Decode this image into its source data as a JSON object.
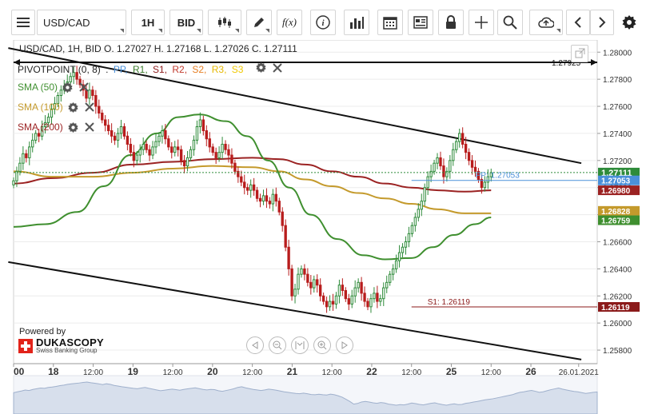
{
  "toolbar": {
    "menu_icon": "hamburger-icon",
    "symbol": "USD/CAD",
    "timeframe": "1H",
    "price_side": "BID",
    "buttons": [
      "candle-type-icon",
      "draw-pencil-icon",
      "fx-icon",
      "info-icon",
      "bar-chart-icon",
      "calendar-icon",
      "news-icon",
      "lock-icon",
      "crosshair-icon",
      "zoom-icon",
      "upload-icon",
      "chevron-left-icon",
      "chevron-right-icon",
      "gear-icon"
    ],
    "fx_label": "f(x)"
  },
  "header": {
    "ohlc_line": "USD/CAD, 1H, BID   O. 1.27027 H. 1.27168 L. 1.27026 C. 1.27111"
  },
  "pivot": {
    "label": "PIVOTPOINT (0, 8)",
    "sep": ":",
    "items": [
      {
        "text": "PP,",
        "color": "#4a90d9"
      },
      {
        "text": "R1,",
        "color": "#3a7a2a"
      },
      {
        "text": "S1,",
        "color": "#8b1a1a"
      },
      {
        "text": "R2,",
        "color": "#c0392b"
      },
      {
        "text": "S2,",
        "color": "#e67e22"
      },
      {
        "text": "R3,",
        "color": "#e6b800"
      },
      {
        "text": "S3",
        "color": "#f0c800"
      }
    ]
  },
  "indicators": [
    {
      "label": "SMA (50)",
      "color": "#3f8f2f"
    },
    {
      "label": "SMA (100)",
      "color": "#c49a2c"
    },
    {
      "label": "SMA (200)",
      "color": "#9b2222"
    }
  ],
  "branding": {
    "powered_by": "Powered by",
    "name": "DUKASCOPY",
    "sub": "Swiss Banking Group"
  },
  "colors": {
    "bull": "#2e8b3a",
    "bear": "#b81d1d",
    "sma50": "#3f8f2f",
    "sma100": "#c49a2c",
    "sma200": "#9b2222",
    "channel": "#111111",
    "pp": "#4a90d9",
    "s1": "#8b1a1a"
  },
  "chart_data": {
    "type": "candlestick",
    "title": "",
    "xlabel": "",
    "ylabel": "",
    "ylim": [
      1.257,
      1.2809
    ],
    "xlim": [
      0,
      220
    ],
    "y_ticks": [
      "1.28000",
      "1.27800",
      "1.27600",
      "1.27400",
      "1.27200",
      "1.27000",
      "1.26800",
      "1.26600",
      "1.26400",
      "1.26200",
      "1.26000",
      "1.25800"
    ],
    "x_tick_labels": [
      {
        "x": 0,
        "label": "00"
      },
      {
        "x": 15,
        "label": "18"
      },
      {
        "x": 30,
        "label": "12:00"
      },
      {
        "x": 45,
        "label": "19"
      },
      {
        "x": 60,
        "label": "12:00"
      },
      {
        "x": 75,
        "label": "20"
      },
      {
        "x": 90,
        "label": "12:00"
      },
      {
        "x": 105,
        "label": "21"
      },
      {
        "x": 120,
        "label": "12:00"
      },
      {
        "x": 135,
        "label": "22"
      },
      {
        "x": 150,
        "label": "12:00"
      },
      {
        "x": 165,
        "label": "25"
      },
      {
        "x": 180,
        "label": "12:00"
      },
      {
        "x": 195,
        "label": "26"
      },
      {
        "x": 213,
        "label": "26.01.2021"
      }
    ],
    "price_labels": [
      {
        "value": "1.27111",
        "y": 1.27111,
        "color": "#2e8b3a",
        "kind": "current"
      },
      {
        "value": "1.27053",
        "y": 1.27053,
        "color": "#4a90d9",
        "kind": "pp"
      },
      {
        "value": "1.26980",
        "y": 1.2698,
        "color": "#9b2222",
        "kind": "sma200"
      },
      {
        "value": "1.26828",
        "y": 1.26828,
        "color": "#c49a2c",
        "kind": "sma100"
      },
      {
        "value": "1.26759",
        "y": 1.26759,
        "color": "#3f8f2f",
        "kind": "sma50"
      },
      {
        "value": "1.26119",
        "y": 1.26119,
        "color": "#8b1a1a",
        "kind": "s1"
      }
    ],
    "hline": {
      "value": "1.27925",
      "y": 1.27925
    },
    "pp_label": "PP: 1.27053",
    "s1_label": "S1: 1.26119",
    "channel_upper": [
      [
        -2,
        1.2803
      ],
      [
        214,
        1.2718
      ]
    ],
    "channel_lower": [
      [
        -2,
        1.2645
      ],
      [
        214,
        1.2573
      ]
    ],
    "sma50": [
      [
        0,
        1.2671
      ],
      [
        12,
        1.2673
      ],
      [
        24,
        1.2682
      ],
      [
        34,
        1.2701
      ],
      [
        44,
        1.2724
      ],
      [
        54,
        1.274
      ],
      [
        62,
        1.2752
      ],
      [
        70,
        1.2754
      ],
      [
        80,
        1.2749
      ],
      [
        88,
        1.2738
      ],
      [
        96,
        1.272
      ],
      [
        104,
        1.27
      ],
      [
        112,
        1.268
      ],
      [
        122,
        1.2662
      ],
      [
        132,
        1.265
      ],
      [
        140,
        1.2647
      ],
      [
        150,
        1.2648
      ],
      [
        158,
        1.2656
      ],
      [
        166,
        1.2665
      ],
      [
        174,
        1.2673
      ],
      [
        180,
        1.2678
      ]
    ],
    "sma100": [
      [
        0,
        1.2712
      ],
      [
        15,
        1.2708
      ],
      [
        30,
        1.2708
      ],
      [
        45,
        1.2711
      ],
      [
        60,
        1.2714
      ],
      [
        75,
        1.2716
      ],
      [
        90,
        1.2715
      ],
      [
        100,
        1.2712
      ],
      [
        110,
        1.2706
      ],
      [
        120,
        1.2701
      ],
      [
        130,
        1.2696
      ],
      [
        140,
        1.2692
      ],
      [
        150,
        1.2688
      ],
      [
        160,
        1.2684
      ],
      [
        170,
        1.2681
      ],
      [
        180,
        1.2681
      ]
    ],
    "sma200": [
      [
        0,
        1.2703
      ],
      [
        15,
        1.2707
      ],
      [
        30,
        1.2711
      ],
      [
        45,
        1.2717
      ],
      [
        60,
        1.2719
      ],
      [
        75,
        1.2721
      ],
      [
        90,
        1.2722
      ],
      [
        100,
        1.2721
      ],
      [
        110,
        1.2717
      ],
      [
        120,
        1.2712
      ],
      [
        130,
        1.2708
      ],
      [
        140,
        1.2703
      ],
      [
        150,
        1.27
      ],
      [
        160,
        1.2698
      ],
      [
        170,
        1.2697
      ],
      [
        180,
        1.2698
      ]
    ],
    "series": [
      {
        "name": "",
        "values": [
          1.2705,
          1.2712,
          1.2718,
          1.2725,
          1.2722,
          1.273,
          1.2735,
          1.274,
          1.2738,
          1.2745,
          1.2748,
          1.2752,
          1.2758,
          1.2762,
          1.2768,
          1.2772,
          1.2775,
          1.2778,
          1.2782,
          1.2785,
          1.278,
          1.2776,
          1.2772,
          1.2766,
          1.2772,
          1.2768,
          1.276,
          1.2755,
          1.275,
          1.2746,
          1.2742,
          1.2738,
          1.2735,
          1.274,
          1.2745,
          1.2738,
          1.2732,
          1.2726,
          1.272,
          1.2724,
          1.2728,
          1.2732,
          1.2728,
          1.2724,
          1.273,
          1.2734,
          1.2738,
          1.2742,
          1.2736,
          1.273,
          1.2726,
          1.273,
          1.2728,
          1.272,
          1.2716,
          1.2722,
          1.2728,
          1.2735,
          1.2745,
          1.275,
          1.2742,
          1.2736,
          1.273,
          1.2726,
          1.2722,
          1.2726,
          1.2732,
          1.2728,
          1.2724,
          1.2718,
          1.2712,
          1.2708,
          1.2704,
          1.27,
          1.2698,
          1.2702,
          1.2698,
          1.2692,
          1.269,
          1.2694,
          1.269,
          1.2688,
          1.2695,
          1.269,
          1.2682,
          1.2672,
          1.2656,
          1.264,
          1.262,
          1.2625,
          1.2636,
          1.264,
          1.2636,
          1.263,
          1.2626,
          1.2632,
          1.2628,
          1.262,
          1.2616,
          1.2612,
          1.2616,
          1.2614,
          1.262,
          1.2628,
          1.2624,
          1.2618,
          1.2614,
          1.262,
          1.2626,
          1.263,
          1.2622,
          1.2616,
          1.2612,
          1.2618,
          1.2622,
          1.2616,
          1.2618,
          1.2626,
          1.263,
          1.2636,
          1.264,
          1.2646,
          1.2652,
          1.2656,
          1.266,
          1.2666,
          1.2672,
          1.2678,
          1.2684,
          1.269,
          1.27,
          1.2708,
          1.2712,
          1.2718,
          1.2722,
          1.2716,
          1.2708,
          1.2712,
          1.272,
          1.2728,
          1.2734,
          1.274,
          1.2732,
          1.2726,
          1.272,
          1.2715,
          1.2712,
          1.2706,
          1.27,
          1.2704,
          1.2708,
          1.2711
        ]
      }
    ]
  }
}
